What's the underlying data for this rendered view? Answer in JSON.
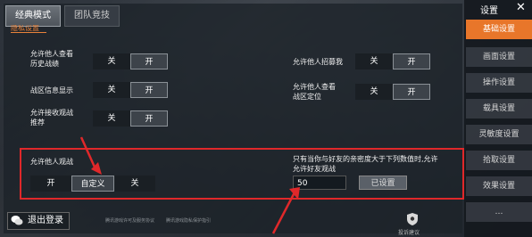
{
  "tabs": [
    "经典模式",
    "团队竞技"
  ],
  "section_title": "隐私设置",
  "rows": [
    {
      "label_l1": "允许他人查看",
      "label_l2": "历史战绩",
      "off": "关",
      "on": "开",
      "state": "on"
    },
    {
      "label_l1": "允许他人招募我",
      "label_l2": "",
      "off": "关",
      "on": "开",
      "state": "on"
    },
    {
      "label_l1": "战区信息显示",
      "label_l2": "",
      "off": "关",
      "on": "开",
      "state": "on"
    },
    {
      "label_l1": "允许他人查看",
      "label_l2": "战区定位",
      "off": "关",
      "on": "开",
      "state": "on"
    },
    {
      "label_l1": "允许接收观战",
      "label_l2": "推荐",
      "off": "关",
      "on": "开",
      "state": "on"
    }
  ],
  "spectate": {
    "label": "允许他人观战",
    "options": [
      "开",
      "自定义",
      "关"
    ],
    "selected": "自定义",
    "hint_l1": "只有当你与好友的亲密度大于下列数值时,允许",
    "hint_l2": "允许好友观战",
    "value": "50",
    "set_button": "已设置"
  },
  "sidebar": {
    "title": "设置",
    "close": "✕",
    "items": [
      "基础设置",
      "画面设置",
      "操作设置",
      "载具设置",
      "灵敏度设置",
      "拾取设置",
      "效果设置",
      "…"
    ],
    "active": "基础设置"
  },
  "footer": {
    "logout": "退出登录",
    "fine1": "腾讯游戏许可及服务协议",
    "fine2": "腾讯游戏隐私保护指引",
    "badge_caption": "投诉建议"
  },
  "colors": {
    "accent": "#e8762a",
    "highlight_box": "#e0282a"
  }
}
